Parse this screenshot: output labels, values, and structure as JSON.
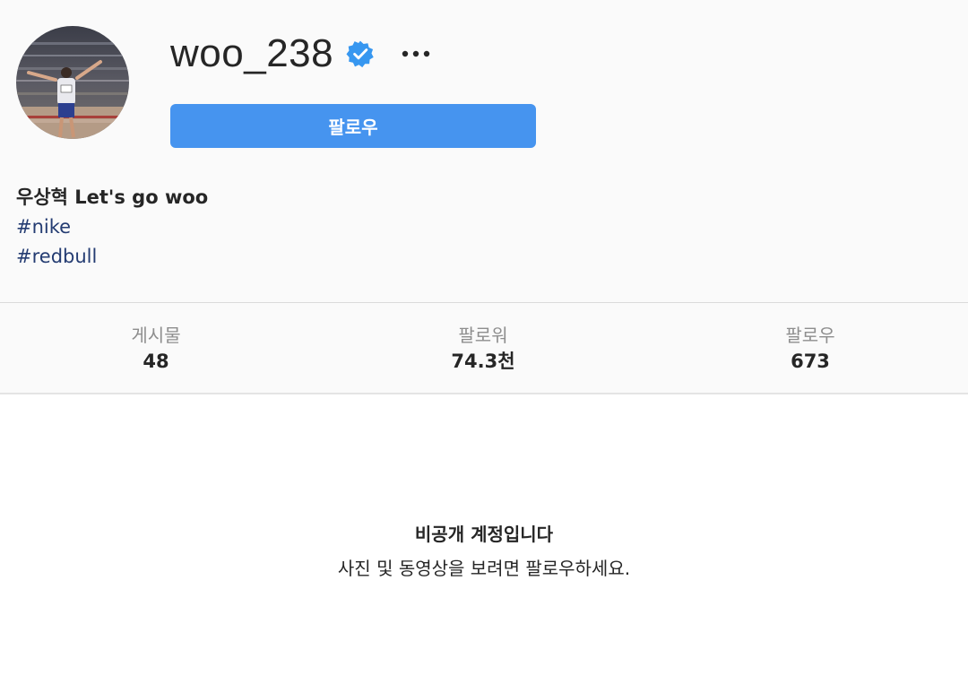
{
  "profile": {
    "username": "woo_238",
    "verified": true,
    "follow_button_label": "팔로우",
    "bio_name": "우상혁 Let's go woo",
    "hashtags": [
      "#nike",
      "#redbull"
    ]
  },
  "stats": [
    {
      "label": "게시물",
      "value": "48"
    },
    {
      "label": "팔로워",
      "value": "74.3천"
    },
    {
      "label": "팔로우",
      "value": "673"
    }
  ],
  "private_notice": {
    "title": "비공개 계정입니다",
    "subtitle": "사진 및 동영상을 보려면 팔로우하세요."
  },
  "icons": {
    "verified": "verified-badge-icon",
    "more": "more-options-icon"
  },
  "colors": {
    "accent": "#4694ef",
    "verified": "#3797f0",
    "hashtag": "#243c72",
    "muted": "#8e8e8e"
  }
}
